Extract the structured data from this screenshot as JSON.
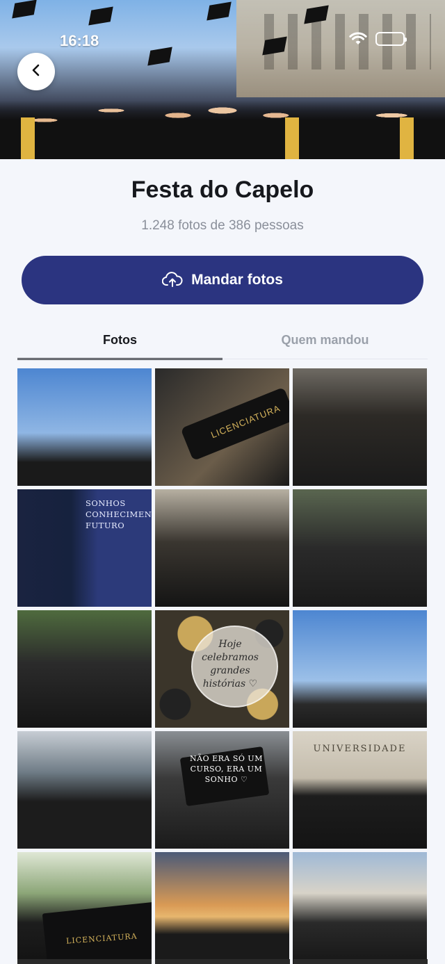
{
  "status_bar": {
    "time": "16:18"
  },
  "header": {
    "back_icon": "chevron-left-icon"
  },
  "event": {
    "title": "Festa do Capelo",
    "subtitle": "1.248 fotos de 386 pessoas"
  },
  "upload": {
    "label": "Mandar fotos",
    "icon": "cloud-upload-icon"
  },
  "tabs": [
    {
      "label": "Fotos",
      "active": true
    },
    {
      "label": "Quem mandou",
      "active": false
    }
  ],
  "photos": {
    "tile_texts": {
      "diploma_roll": "LICENCIATURA",
      "banner": "SONHOS CONHECIMENTO FUTURO",
      "balloon": "Hoje celebramos grandes histórias ♡",
      "cap": "NÃO ERA SÓ UM CURSO, ERA UM SONHO ♡",
      "building": "UNIVERSIDADE",
      "diploma_book": "LICENCIATURA"
    }
  },
  "colors": {
    "primary_button": "#2b3480",
    "background": "#f4f6fb",
    "accent_gold": "#e0b441"
  }
}
